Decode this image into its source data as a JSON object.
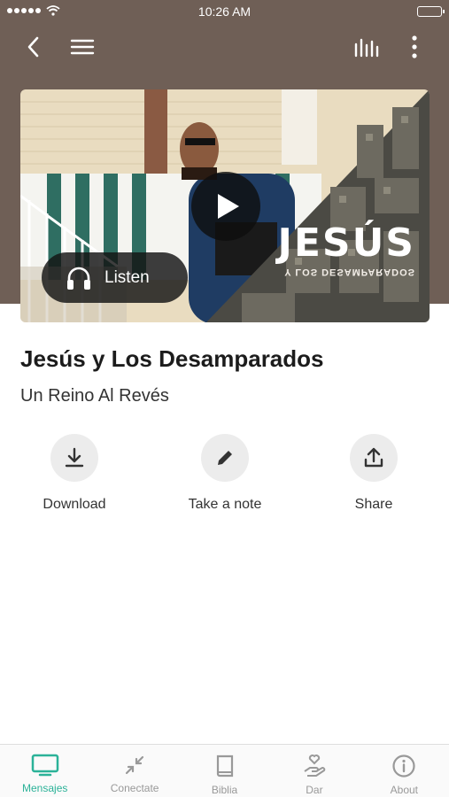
{
  "status_bar": {
    "time": "10:26 AM"
  },
  "header": {},
  "hero": {
    "title_overlay": "JESÚS",
    "subtitle_overlay": "Y LOS DESAMPARADOS",
    "listen_label": "Listen"
  },
  "message": {
    "title": "Jesús y Los Desamparados",
    "series": "Un Reino Al Revés"
  },
  "actions": [
    {
      "label": "Download",
      "icon": "download-icon"
    },
    {
      "label": "Take a note",
      "icon": "pencil-icon"
    },
    {
      "label": "Share",
      "icon": "share-icon"
    }
  ],
  "tabs": [
    {
      "label": "Mensajes",
      "icon": "tv-icon",
      "active": true
    },
    {
      "label": "Conectate",
      "icon": "arrows-icon",
      "active": false
    },
    {
      "label": "Biblia",
      "icon": "book-icon",
      "active": false
    },
    {
      "label": "Dar",
      "icon": "give-icon",
      "active": false
    },
    {
      "label": "About",
      "icon": "info-icon",
      "active": false
    }
  ],
  "colors": {
    "header_bg": "#6f5f56",
    "accent": "#2bb298",
    "inactive_tab": "#999999"
  }
}
